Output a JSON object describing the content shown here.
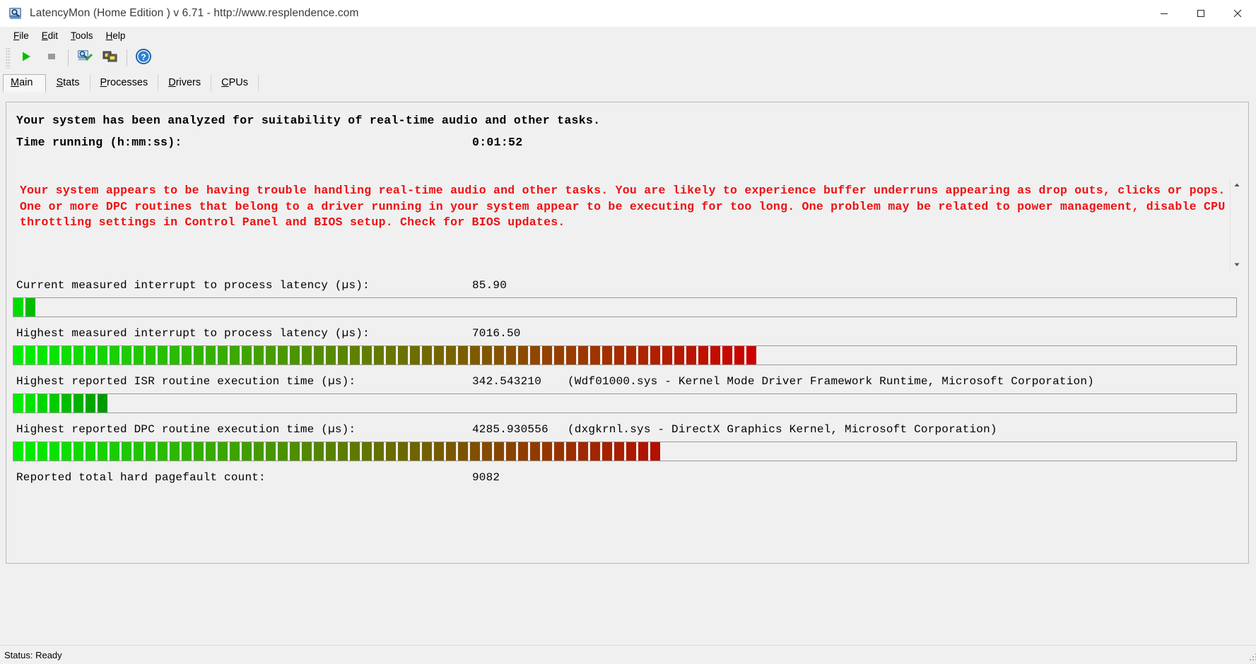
{
  "window": {
    "title": "LatencyMon  (Home Edition )  v 6.71 - http://www.resplendence.com",
    "icon": "latencymon-app-icon",
    "minimize_label": "—",
    "maximize_label": "☐",
    "close_label": "✕"
  },
  "menubar": {
    "items": [
      {
        "label": "File",
        "accel": "F"
      },
      {
        "label": "Edit",
        "accel": "E"
      },
      {
        "label": "Tools",
        "accel": "T"
      },
      {
        "label": "Help",
        "accel": "H"
      }
    ]
  },
  "toolbar": {
    "buttons": [
      {
        "name": "start-monitoring-button",
        "icon": "play-icon"
      },
      {
        "name": "stop-monitoring-button",
        "icon": "stop-icon"
      },
      {
        "name": "system-info-button",
        "icon": "computer-search-icon"
      },
      {
        "name": "copy-report-button",
        "icon": "copy-windows-icon"
      },
      {
        "name": "help-button",
        "icon": "question-circle-icon"
      }
    ]
  },
  "tabs": [
    {
      "label": "Main",
      "accel": "M",
      "active": true
    },
    {
      "label": "Stats",
      "accel": "S",
      "active": false
    },
    {
      "label": "Processes",
      "accel": "P",
      "active": false
    },
    {
      "label": "Drivers",
      "accel": "D",
      "active": false
    },
    {
      "label": "CPUs",
      "accel": "C",
      "active": false
    }
  ],
  "summary": {
    "analysis_line": "Your system has been analyzed for suitability of real-time audio and other tasks.",
    "time_running_label": "Time running (h:mm:ss):",
    "time_running_value": "0:01:52"
  },
  "warning": {
    "color": "#ee1111",
    "text": "Your system appears to be having trouble handling real-time audio and other tasks. You are likely to experience buffer underruns appearing as drop outs, clicks or pops. One or more DPC routines that belong to a driver running in your system appear to be executing for too long. One problem may be related to power management, disable CPU throttling settings in Control Panel and BIOS setup. Check for BIOS updates.",
    "scroll_up_icon": "chevron-up-icon",
    "scroll_down_icon": "chevron-down-icon"
  },
  "metrics": [
    {
      "name": "current-interrupt-to-process-latency",
      "label": "Current measured interrupt to process latency (µs):",
      "value": "85.90",
      "description": "",
      "bar": {
        "segments": 2,
        "start_color": "#00dd00",
        "end_color": "#00bb00",
        "fraction": 0.0115
      }
    },
    {
      "name": "highest-interrupt-to-process-latency",
      "label": "Highest measured interrupt to process latency (µs):",
      "value": "7016.50",
      "description": "",
      "bar": {
        "segments": 62,
        "start_color": "#00ee00",
        "end_color": "#cc0000",
        "fraction": 0.615
      }
    },
    {
      "name": "highest-isr-routine-execution-time",
      "label": "Highest reported ISR routine execution time (µs):",
      "value": "342.543210",
      "description": "(Wdf01000.sys - Kernel Mode Driver Framework Runtime, Microsoft Corporation)",
      "bar": {
        "segments": 8,
        "start_color": "#00ee00",
        "end_color": "#009900",
        "fraction": 0.083
      }
    },
    {
      "name": "highest-dpc-routine-execution-time",
      "label": "Highest reported DPC routine execution time (µs):",
      "value": "4285.930556",
      "description": "(dxgkrnl.sys - DirectX Graphics Kernel, Microsoft Corporation)",
      "bar": {
        "segments": 54,
        "start_color": "#00ee00",
        "end_color": "#b31000",
        "fraction": 0.533
      }
    },
    {
      "name": "reported-total-hard-pagefault-count",
      "label": "Reported total hard pagefault count:",
      "value": "9082",
      "description": "",
      "bar": null
    }
  ],
  "statusbar": {
    "text": "Status: Ready"
  }
}
